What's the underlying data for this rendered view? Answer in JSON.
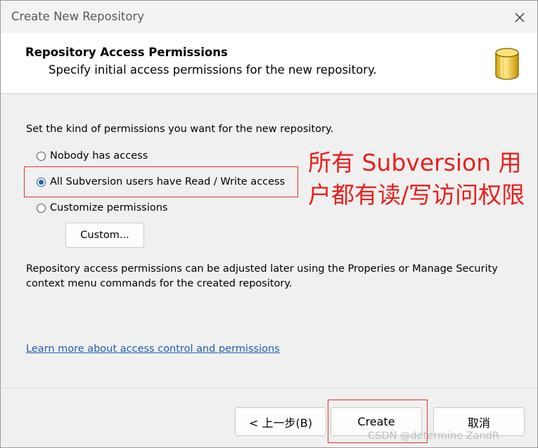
{
  "window": {
    "title": "Create New Repository"
  },
  "header": {
    "title": "Repository Access Permissions",
    "subtitle": "Specify initial access permissions for the new repository."
  },
  "main": {
    "intro": "Set the kind of permissions you want for the new repository.",
    "options": [
      {
        "label": "Nobody has access",
        "checked": false
      },
      {
        "label": "All Subversion users have Read / Write access",
        "checked": true
      },
      {
        "label": "Customize permissions",
        "checked": false
      }
    ],
    "custom_button": "Custom...",
    "note": "Repository access permissions can be adjusted later using the Properies or Manage Security context menu commands for the created repository.",
    "link": "Learn more about access control and permissions"
  },
  "annotation": {
    "text": "所有 Subversion 用户都有读/写访问权限",
    "color": "#e8201c"
  },
  "footer": {
    "back": "< 上一步(B)",
    "create": "Create",
    "cancel": "取消"
  },
  "watermark": "CSDN @determine  ZandR",
  "colors": {
    "link": "#1a5fb4",
    "highlight_border": "#e03030",
    "radio_selected": "#1d5fa8"
  },
  "icons": {
    "close": "close-icon",
    "repository": "database-icon"
  }
}
